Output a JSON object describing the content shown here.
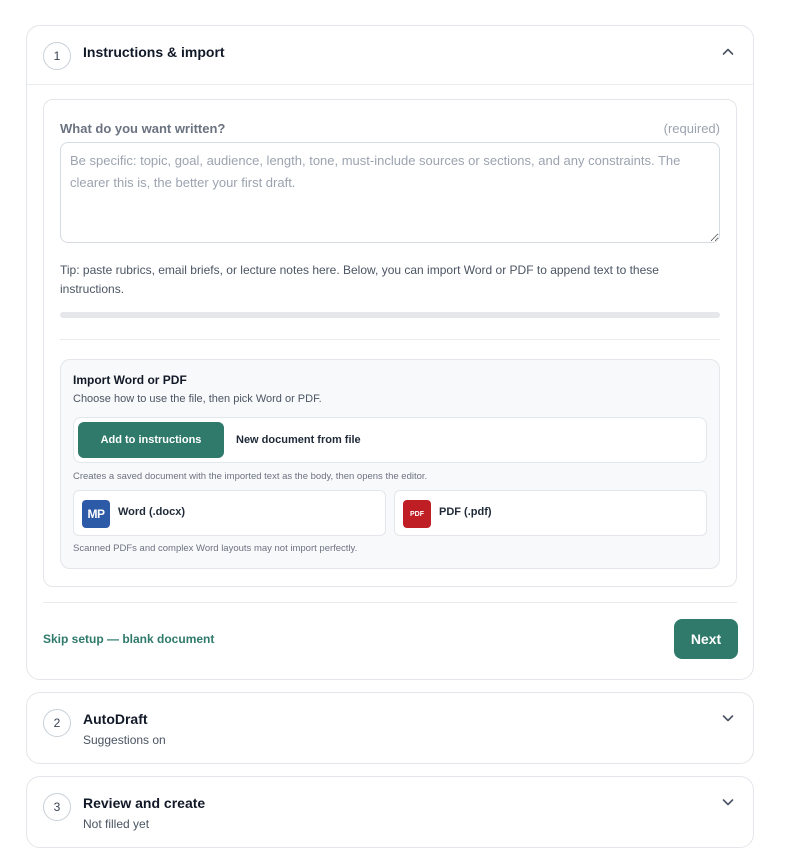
{
  "steps": [
    {
      "number": "1",
      "title": "Instructions & import"
    },
    {
      "number": "2",
      "title": "AutoDraft",
      "subtitle": "Suggestions on"
    },
    {
      "number": "3",
      "title": "Review and create",
      "subtitle": "Not filled yet"
    }
  ],
  "instructions": {
    "label": "What do you want written?",
    "required": "(required)",
    "value": "",
    "placeholder": "Be specific: topic, goal, audience, length, tone, must-include sources or sections, and any constraints. The clearer this is, the better your first draft.",
    "tip": "Tip: paste rubrics, email briefs, or lecture notes here. Below, you can import Word or PDF to append text to these instructions.",
    "progress": 0
  },
  "import": {
    "title": "Import Word or PDF",
    "subtitle": "Choose how to use the file, then pick Word or PDF.",
    "mode_add": "Add to instructions",
    "mode_new": "New document from file",
    "mode_note": "Creates a saved document with the imported text as the body, then opens the editor.",
    "word_icon_text": "MP",
    "word_label": "Word (.docx)",
    "pdf_icon_text": "PDF",
    "pdf_label": "PDF (.pdf)",
    "footnote": "Scanned PDFs and complex Word layouts may not import perfectly."
  },
  "actions": {
    "skip": "Skip setup — blank document",
    "next": "Next"
  },
  "icons": {
    "collapse": "chevron-up-icon",
    "expand": "chevron-down-icon",
    "word": "word-file-icon",
    "pdf": "pdf-file-icon"
  },
  "colors": {
    "accent": "#2f7a6b",
    "word": "#2d5aa6",
    "pdf": "#bf1e24"
  }
}
